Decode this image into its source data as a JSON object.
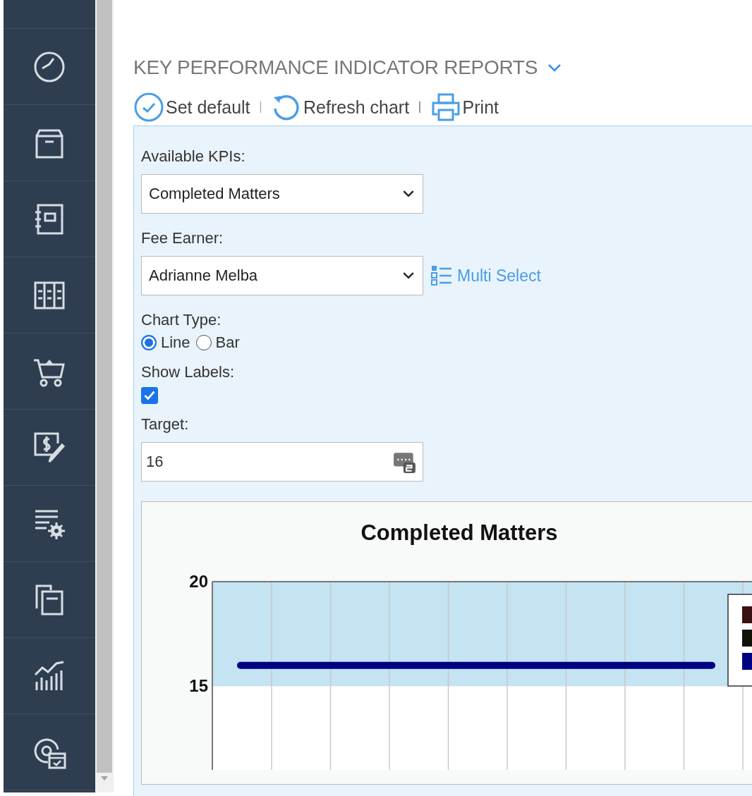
{
  "sidebar": {
    "items": [
      {
        "kind": "partial"
      },
      {
        "kind": "clock"
      },
      {
        "kind": "box"
      },
      {
        "kind": "notebook"
      },
      {
        "kind": "binders"
      },
      {
        "kind": "cart"
      },
      {
        "kind": "invoice"
      },
      {
        "kind": "list-settings"
      },
      {
        "kind": "documents"
      },
      {
        "kind": "chart"
      },
      {
        "kind": "gear-calendar"
      }
    ]
  },
  "title": "KEY PERFORMANCE INDICATOR REPORTS",
  "toolbar": [
    {
      "kind": "set-default",
      "label": "Set default"
    },
    {
      "kind": "refresh",
      "label": "Refresh chart"
    },
    {
      "kind": "print",
      "label": "Print"
    }
  ],
  "form": {
    "kpi_label": "Available KPIs:",
    "kpi_value": "Completed Matters",
    "fee_earner_label": "Fee Earner:",
    "fee_earner_value": "Adrianne Melba",
    "multi_select": "Multi Select",
    "chart_type_label": "Chart Type:",
    "chart_types": [
      {
        "label": "Line",
        "selected": true
      },
      {
        "label": "Bar",
        "selected": false
      }
    ],
    "show_labels_label": "Show Labels:",
    "show_labels": {
      "checked": true
    },
    "target_label": "Target:",
    "target_value": "16"
  },
  "chart": {
    "legend": [
      {
        "color": "#3a1010"
      },
      {
        "color": "#101408"
      },
      {
        "color": "#000080"
      }
    ],
    "chart_data": {
      "type": "line",
      "title": "Completed Matters",
      "ylim": [
        11,
        20
      ],
      "yticks": [
        20,
        15
      ],
      "series": [
        {
          "color": "#000080",
          "values": [
            16,
            16,
            16,
            16,
            16,
            16,
            16,
            16,
            16
          ]
        }
      ]
    }
  }
}
